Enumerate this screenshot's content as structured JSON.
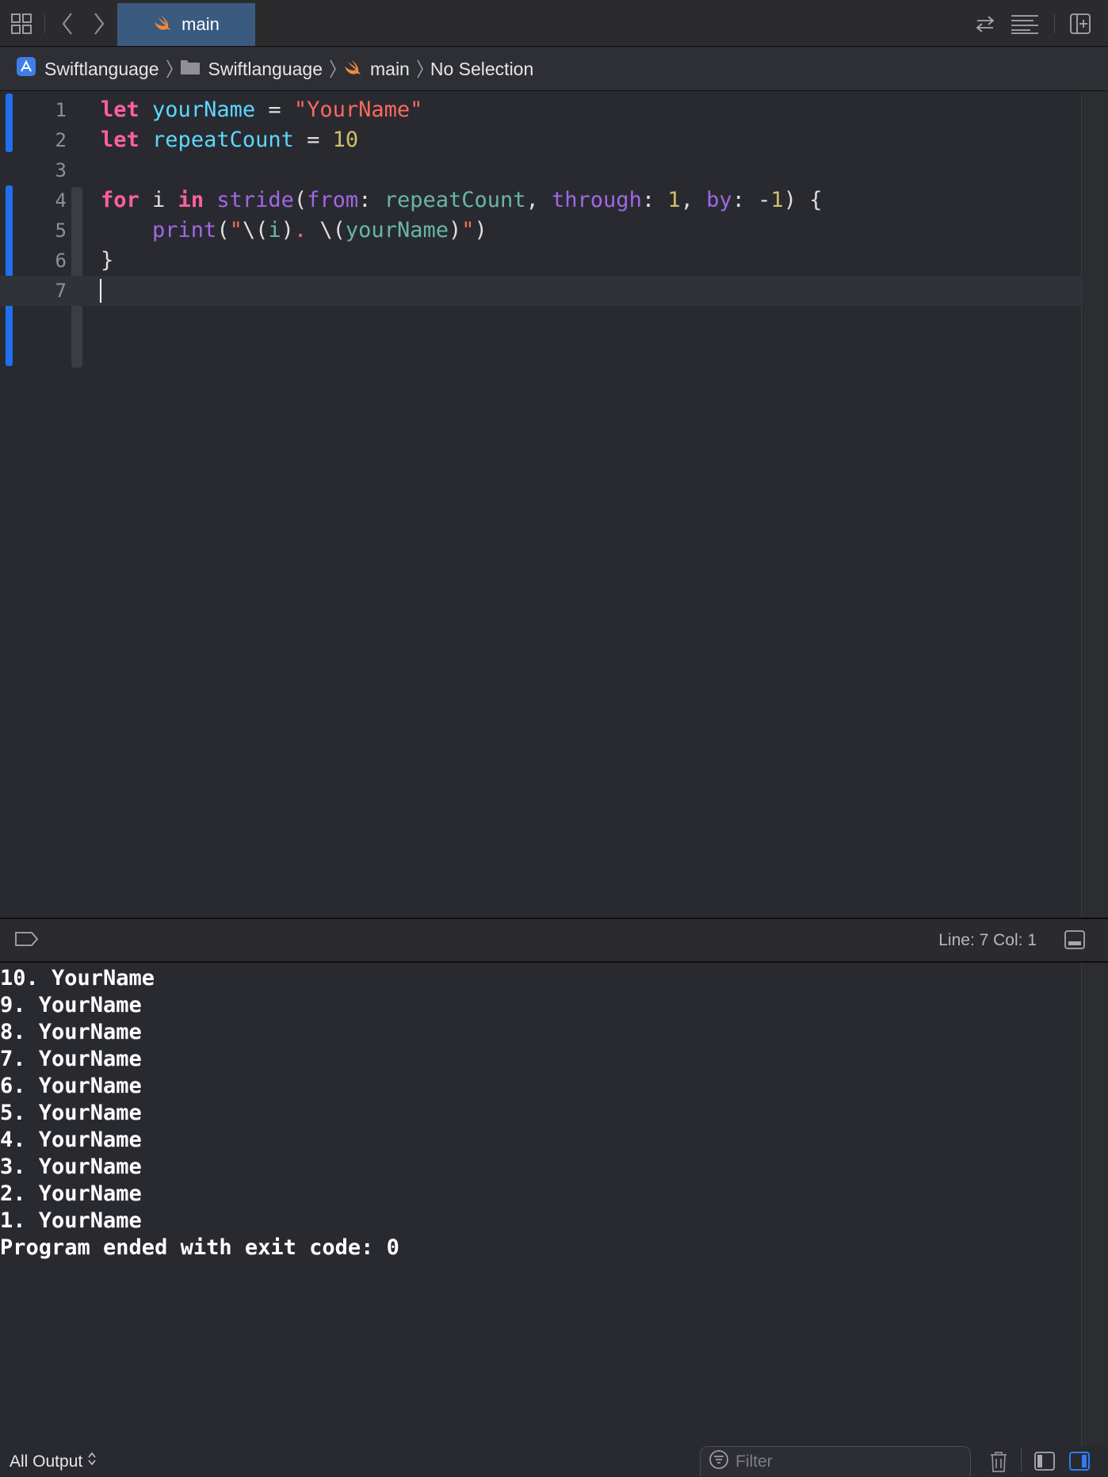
{
  "tabbar": {
    "active_tab": "main",
    "icons": [
      "grid-icon",
      "back-icon",
      "forward-icon",
      "swift-icon",
      "swap-icon",
      "lines-icon",
      "add-editor-icon"
    ]
  },
  "jumpbar": {
    "project": "Swiftlanguage",
    "folder": "Swiftlanguage",
    "file": "main",
    "selection": "No Selection"
  },
  "editor": {
    "line_numbers": [
      "1",
      "2",
      "3",
      "4",
      "5",
      "6",
      "7"
    ],
    "current_line": 7,
    "lines": [
      [
        {
          "t": "kw",
          "s": "let"
        },
        {
          "t": "txt",
          "s": " "
        },
        {
          "t": "fn",
          "s": "yourName"
        },
        {
          "t": "txt",
          "s": " = "
        },
        {
          "t": "str",
          "s": "\"YourName\""
        }
      ],
      [
        {
          "t": "kw",
          "s": "let"
        },
        {
          "t": "txt",
          "s": " "
        },
        {
          "t": "fn",
          "s": "repeatCount"
        },
        {
          "t": "txt",
          "s": " = "
        },
        {
          "t": "num",
          "s": "10"
        }
      ],
      [],
      [
        {
          "t": "kw",
          "s": "for"
        },
        {
          "t": "txt",
          "s": " i "
        },
        {
          "t": "kw",
          "s": "in"
        },
        {
          "t": "txt",
          "s": " "
        },
        {
          "t": "lib",
          "s": "stride"
        },
        {
          "t": "txt",
          "s": "("
        },
        {
          "t": "lbl",
          "s": "from"
        },
        {
          "t": "txt",
          "s": ": "
        },
        {
          "t": "id",
          "s": "repeatCount"
        },
        {
          "t": "txt",
          "s": ", "
        },
        {
          "t": "lbl",
          "s": "through"
        },
        {
          "t": "txt",
          "s": ": "
        },
        {
          "t": "num",
          "s": "1"
        },
        {
          "t": "txt",
          "s": ", "
        },
        {
          "t": "lbl",
          "s": "by"
        },
        {
          "t": "txt",
          "s": ": -"
        },
        {
          "t": "num",
          "s": "1"
        },
        {
          "t": "txt",
          "s": ") {"
        }
      ],
      [
        {
          "t": "txt",
          "s": "    "
        },
        {
          "t": "lib",
          "s": "print"
        },
        {
          "t": "txt",
          "s": "("
        },
        {
          "t": "str",
          "s": "\""
        },
        {
          "t": "txt",
          "s": "\\("
        },
        {
          "t": "id",
          "s": "i"
        },
        {
          "t": "txt",
          "s": ")"
        },
        {
          "t": "str",
          "s": ". "
        },
        {
          "t": "txt",
          "s": "\\("
        },
        {
          "t": "id",
          "s": "yourName"
        },
        {
          "t": "txt",
          "s": ")"
        },
        {
          "t": "str",
          "s": "\""
        },
        {
          "t": "txt",
          "s": ")"
        }
      ],
      [
        {
          "t": "txt",
          "s": "}"
        }
      ],
      []
    ]
  },
  "debugbar": {
    "position": "Line: 7  Col: 1"
  },
  "console": {
    "output": [
      "10. YourName",
      "9. YourName",
      "8. YourName",
      "7. YourName",
      "6. YourName",
      "5. YourName",
      "4. YourName",
      "3. YourName",
      "2. YourName",
      "1. YourName",
      "Program ended with exit code: 0"
    ]
  },
  "bottombar": {
    "output_mode": "All Output",
    "filter_placeholder": "Filter",
    "filter_value": ""
  },
  "colors": {
    "keyword": "#fc5fa3",
    "string": "#fc6a5d",
    "number": "#d0bf69",
    "declaration": "#5dd8ff",
    "identifier": "#67b7a4",
    "library": "#a167e6",
    "active_tab": "#3a5a80",
    "change_marker": "#1f6ff0"
  }
}
